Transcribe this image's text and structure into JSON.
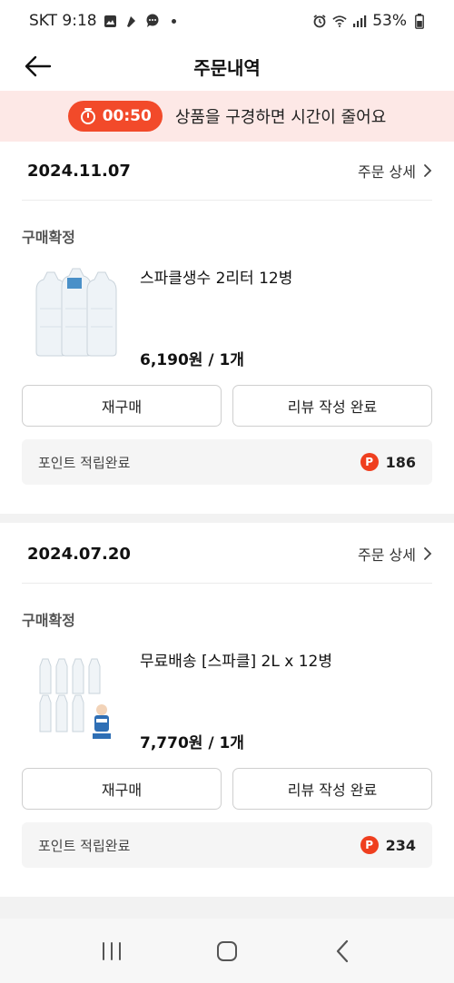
{
  "status_bar": {
    "carrier_time": "SKT 9:18",
    "battery": "53%"
  },
  "header": {
    "title": "주문내역"
  },
  "banner": {
    "timer": "00:50",
    "message": "상품을 구경하면 시간이 줄어요"
  },
  "orders": [
    {
      "date": "2024.11.07",
      "detail_label": "주문 상세",
      "status": "구매확정",
      "product_name": "스파클생수 2리터 12병",
      "price": "6,190원 / 1개",
      "rebuy_label": "재구매",
      "review_label": "리뷰 작성 완료",
      "points_label": "포인트 적립완료",
      "points_badge": "P",
      "points_value": "186"
    },
    {
      "date": "2024.07.20",
      "detail_label": "주문 상세",
      "status": "구매확정",
      "product_name": "무료배송 [스파클] 2L x 12병",
      "price": "7,770원 / 1개",
      "rebuy_label": "재구매",
      "review_label": "리뷰 작성 완료",
      "points_label": "포인트 적립완료",
      "points_badge": "P",
      "points_value": "234"
    }
  ],
  "colors": {
    "accent": "#f24a2a",
    "banner_bg": "#fde8e6"
  }
}
